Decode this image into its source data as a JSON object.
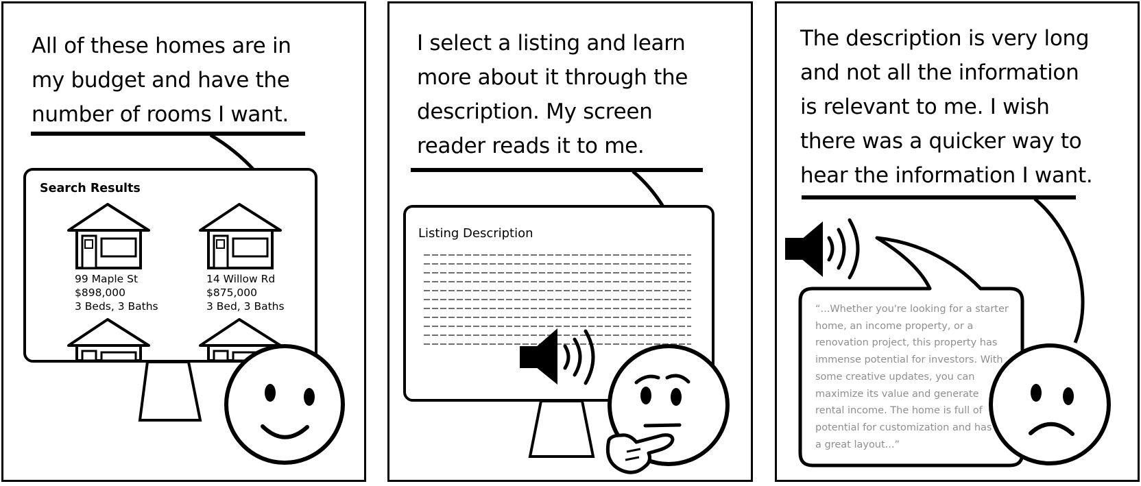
{
  "panels": [
    {
      "caption": [
        "All of these homes are in",
        "my budget and have the",
        "number of rooms I want."
      ],
      "screen_title": "Search Results",
      "listings": [
        {
          "address": "99 Maple St",
          "price": "$898,000",
          "rooms": "3 Beds, 3 Baths"
        },
        {
          "address": "14 Willow Rd",
          "price": "$875,000",
          "rooms": "3 Bed, 3 Baths"
        }
      ],
      "face": "happy-face"
    },
    {
      "caption": [
        "I select a listing and learn",
        "more about it through the",
        "description. My screen",
        "reader reads it to me."
      ],
      "screen_title": "Listing Description",
      "face": "thinking-face"
    },
    {
      "caption": [
        "The description is very long",
        "and not all the information",
        "is relevant to me. I wish",
        "there was a quicker way to",
        "hear the information I want."
      ],
      "quote": [
        "“...Whether you're looking for a starter",
        "home, an income property, or a",
        "renovation project, this property has",
        "immense potential for investors. With",
        "some creative updates, you can",
        "maximize its value and generate",
        "rental income. The home is full of",
        "potential for customization and has",
        "a great layout...”"
      ],
      "face": "sad-face"
    }
  ],
  "colors": {
    "ink": "#000000",
    "quote_text": "#8f8f8f",
    "background": "#ffffff"
  },
  "icons": [
    "house-icon",
    "speaker-icon"
  ]
}
